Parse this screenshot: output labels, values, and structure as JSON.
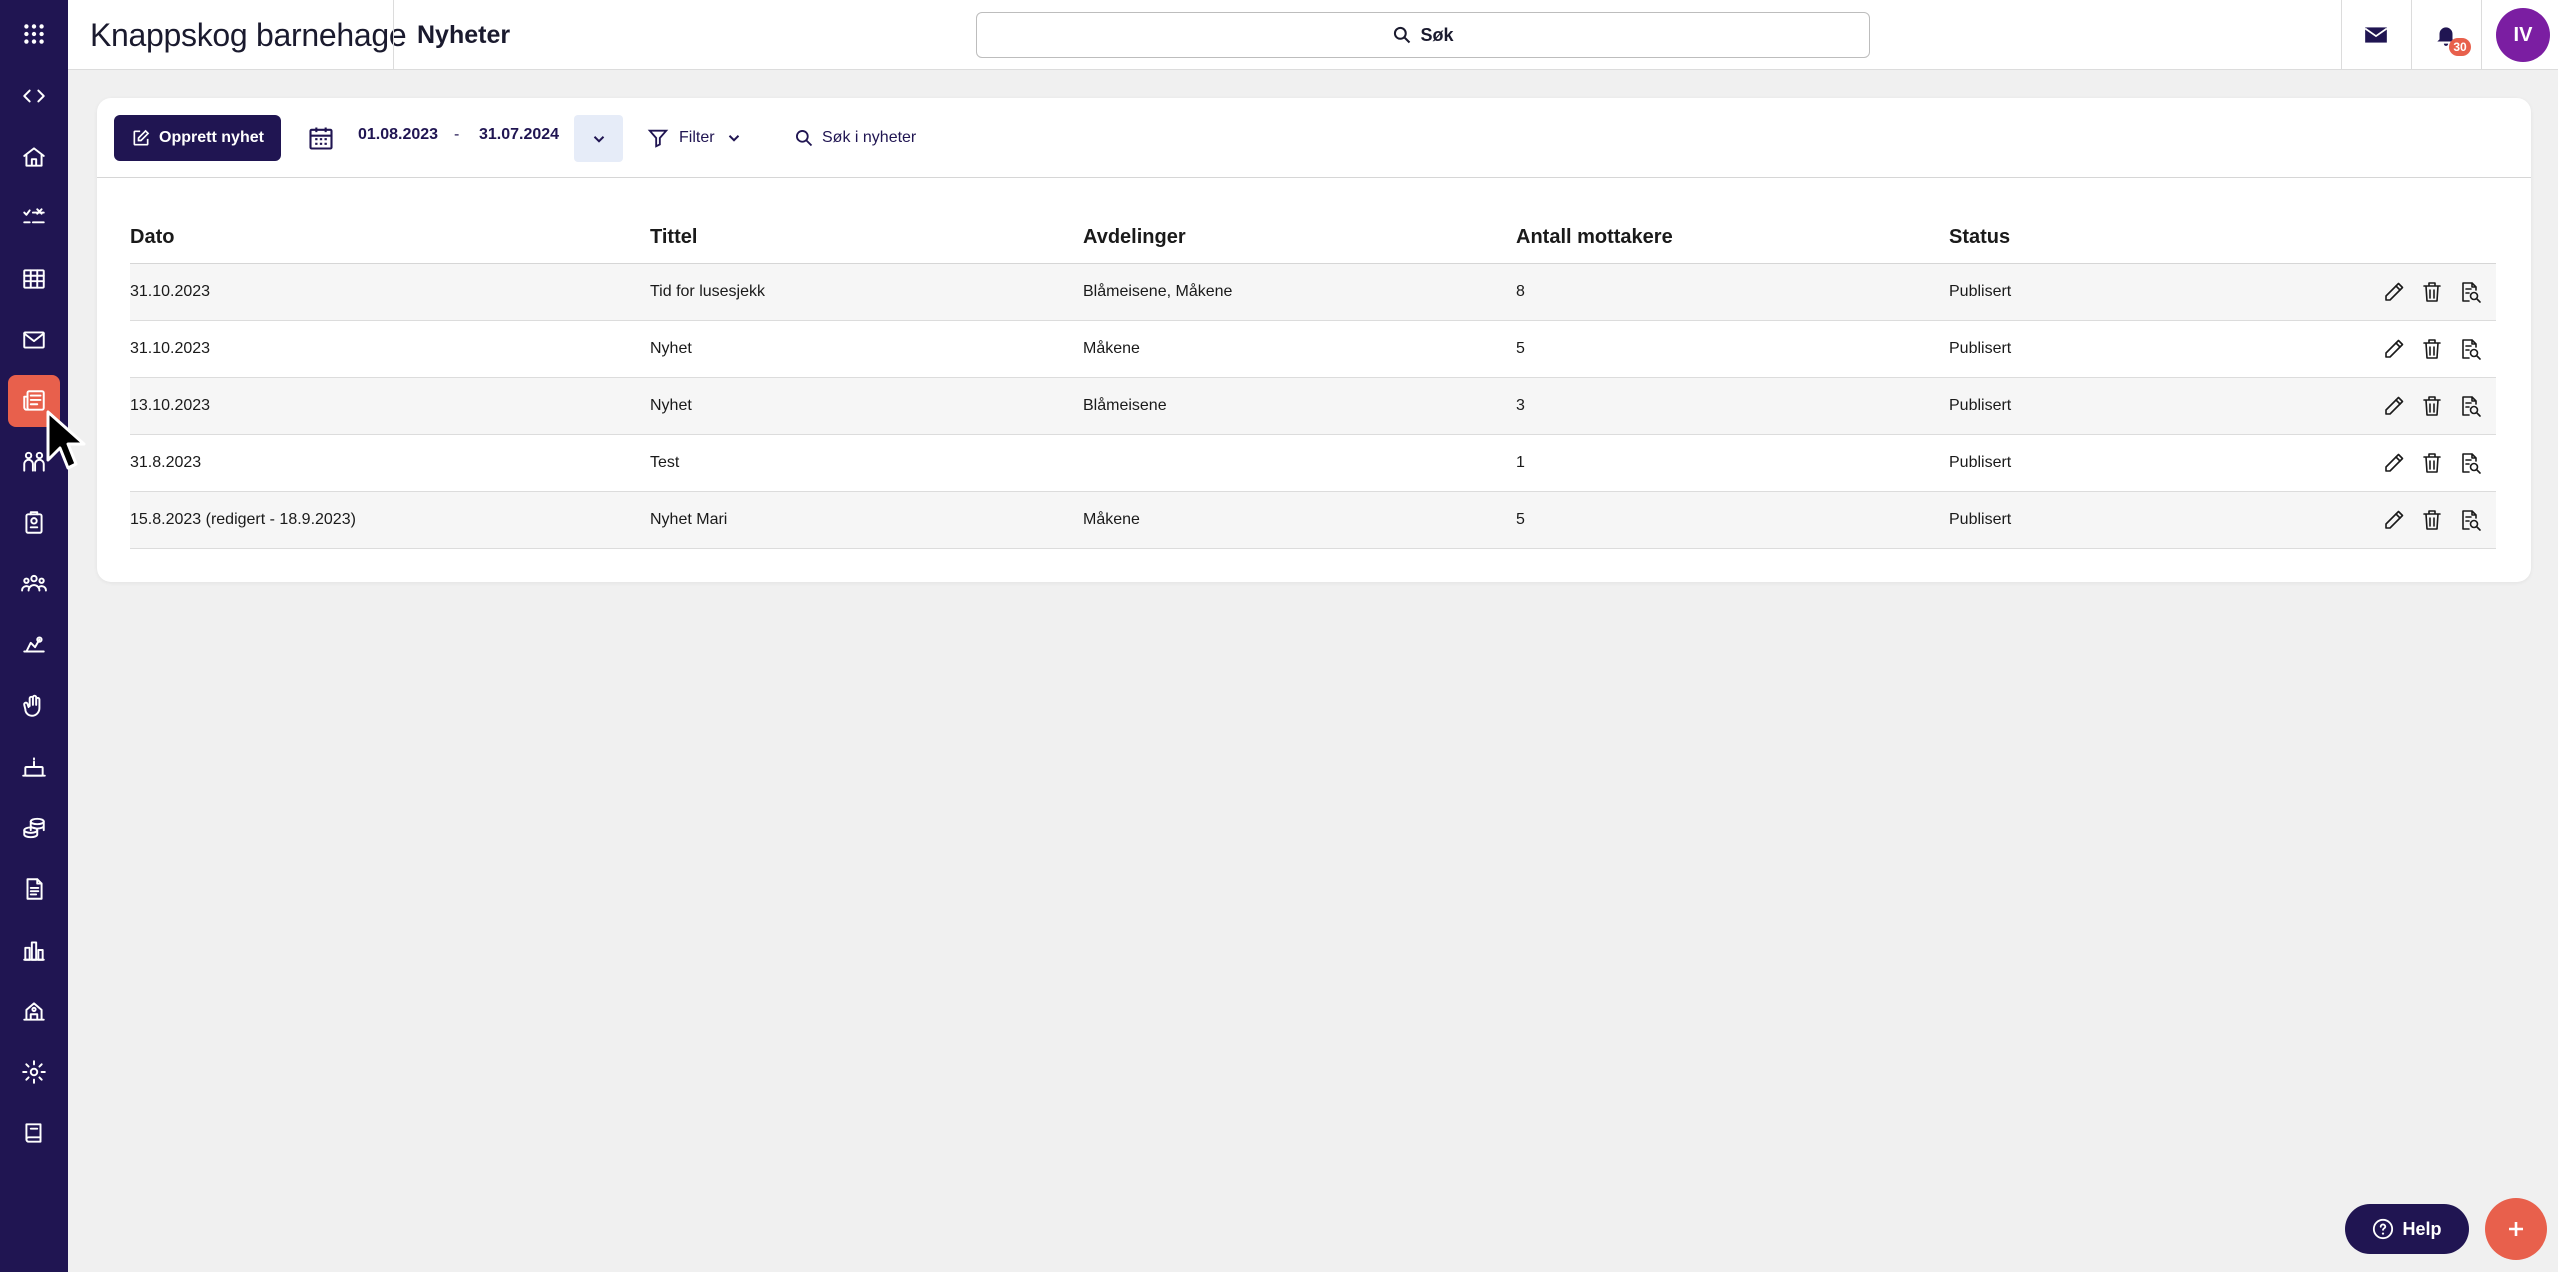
{
  "header": {
    "org_name": "Knappskog barnehage",
    "page_title": "Nyheter",
    "search_label": "Søk",
    "notification_count": "30",
    "avatar_initials": "IV"
  },
  "sidebar": {
    "items": [
      {
        "icon": "code-icon"
      },
      {
        "icon": "home-icon"
      },
      {
        "icon": "checklist-icon"
      },
      {
        "icon": "calendar-grid-icon"
      },
      {
        "icon": "mail-icon"
      },
      {
        "icon": "news-icon",
        "active": true
      },
      {
        "icon": "children-icon"
      },
      {
        "icon": "badge-icon"
      },
      {
        "icon": "group-icon"
      },
      {
        "icon": "activity-icon"
      },
      {
        "icon": "hand-icon"
      },
      {
        "icon": "cake-icon"
      },
      {
        "icon": "coins-icon"
      },
      {
        "icon": "document-icon"
      },
      {
        "icon": "bar-chart-icon"
      },
      {
        "icon": "building-icon"
      },
      {
        "icon": "gear-icon"
      },
      {
        "icon": "book-icon"
      }
    ]
  },
  "toolbar": {
    "create_label": "Opprett nyhet",
    "date_from": "01.08.2023",
    "date_separator": "-",
    "date_to": "31.07.2024",
    "filter_label": "Filter",
    "search_label": "Søk i nyheter"
  },
  "table": {
    "columns": [
      "Dato",
      "Tittel",
      "Avdelinger",
      "Antall mottakere",
      "Status"
    ],
    "rows": [
      {
        "date": "31.10.2023",
        "title": "Tid for lusesjekk",
        "departments": "Blåmeisene, Måkene",
        "recipients": "8",
        "status": "Publisert"
      },
      {
        "date": "31.10.2023",
        "title": "Nyhet",
        "departments": "Måkene",
        "recipients": "5",
        "status": "Publisert"
      },
      {
        "date": "13.10.2023",
        "title": "Nyhet",
        "departments": "Blåmeisene",
        "recipients": "3",
        "status": "Publisert"
      },
      {
        "date": "31.8.2023",
        "title": "Test",
        "departments": "",
        "recipients": "1",
        "status": "Publisert"
      },
      {
        "date": "15.8.2023 (redigert - 18.9.2023)",
        "title": "Nyhet Mari",
        "departments": "Måkene",
        "recipients": "5",
        "status": "Publisert"
      }
    ]
  },
  "help_label": "Help",
  "colors": {
    "sidebar": "#201552",
    "accent": "#e8604c",
    "avatar": "#7b1ea2",
    "background": "#f0f0f0"
  }
}
